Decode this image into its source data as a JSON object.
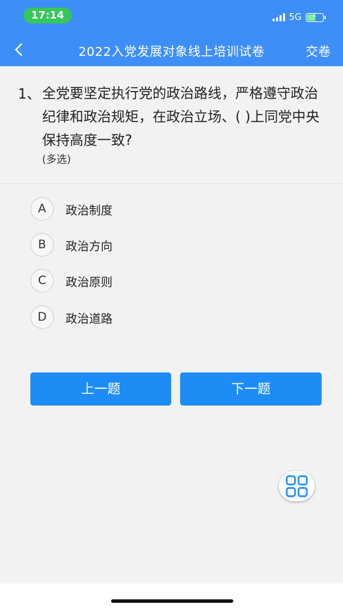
{
  "status_bar": {
    "time": "17:14",
    "network": "5G"
  },
  "nav": {
    "title": "2022入党发展对象线上培训试卷",
    "submit_label": "交卷"
  },
  "question": {
    "number": "1、",
    "text": "全党要坚定执行党的政治路线，严格遵守政治纪律和政治规矩，在政治立场、( )上同党中央保持高度一致?",
    "type_label": "(多选)"
  },
  "options": [
    {
      "letter": "A",
      "text": "政治制度"
    },
    {
      "letter": "B",
      "text": "政治方向"
    },
    {
      "letter": "C",
      "text": "政治原则"
    },
    {
      "letter": "D",
      "text": "政治道路"
    }
  ],
  "buttons": {
    "prev_label": "上一题",
    "next_label": "下一题"
  },
  "colors": {
    "header_bg": "#3e8ef7",
    "button_bg": "#1e8cf5",
    "time_pill": "#35c759"
  },
  "icons": {
    "back": "chevron-left-icon",
    "answer_sheet": "grid-icon"
  }
}
